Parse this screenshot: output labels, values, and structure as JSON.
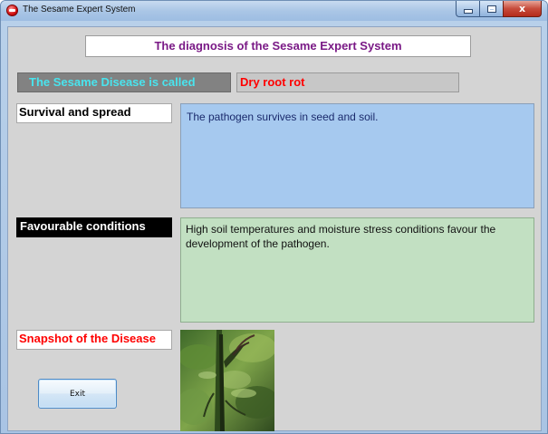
{
  "window": {
    "title": "The Sesame Expert System",
    "buttons": {
      "minimize": "–",
      "maximize": "□",
      "close": "x"
    }
  },
  "header": {
    "title": "The diagnosis of the Sesame Expert System"
  },
  "disease": {
    "label": "The Sesame Disease is called",
    "name": "Dry root rot"
  },
  "survival": {
    "label": "Survival and spread",
    "text": "The pathogen survives in seed and soil."
  },
  "conditions": {
    "label": "Favourable conditions",
    "text": "High soil temperatures and moisture stress conditions favour the development of the pathogen."
  },
  "snapshot": {
    "label": "Snapshot of the Disease"
  },
  "actions": {
    "exit_label": "Exit"
  },
  "colors": {
    "window_chrome": "#aac6e6",
    "client_bg": "#d4d4d4",
    "header_text": "#7a1a86",
    "disease_label_bg": "#828282",
    "disease_label_text": "#49e4ee",
    "disease_name_text": "#ff0000",
    "survival_panel_bg": "#a6c9ef",
    "conditions_panel_bg": "#c2e0c2",
    "snapshot_label_text": "#ff0000"
  },
  "icons": {
    "app": "red-round-app-icon",
    "minimize": "minimize-icon",
    "maximize": "maximize-icon",
    "close": "close-icon"
  }
}
